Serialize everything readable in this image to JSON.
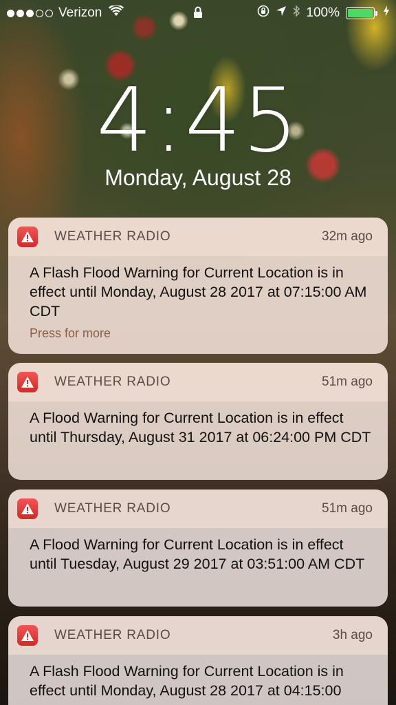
{
  "status_bar": {
    "carrier": "Verizon",
    "battery": "100%",
    "signal_bars_filled": 3,
    "signal_bars_total": 5,
    "icons": [
      "wifi-icon",
      "lock-icon",
      "orientation-lock-icon",
      "location-arrow-icon",
      "bluetooth-icon",
      "charging-icon"
    ]
  },
  "lock_screen": {
    "time": "4:45",
    "date": "Monday, August 28"
  },
  "notifications": [
    {
      "app": "WEATHER RADIO",
      "time": "32m ago",
      "text": "A Flash Flood Warning for Current Location is in effect until Monday, August 28 2017 at 07:15:00 AM CDT",
      "action": "Press for more"
    },
    {
      "app": "WEATHER RADIO",
      "time": "51m ago",
      "text": "A Flood Warning for Current Location is in effect until Thursday, August 31 2017 at 06:24:00 PM CDT"
    },
    {
      "app": "WEATHER RADIO",
      "time": "51m ago",
      "text": "A Flood Warning for Current Location is in effect until Tuesday, August 29 2017 at 03:51:00 AM CDT"
    },
    {
      "app": "WEATHER RADIO",
      "time": "3h ago",
      "text": "A Flash Flood Warning for Current Location is in effect until Monday, August 28 2017 at 04:15:00"
    }
  ],
  "colors": {
    "app_icon": "#e03a3a",
    "battery_fill": "#4cd964",
    "action_text": "#8a6048"
  }
}
